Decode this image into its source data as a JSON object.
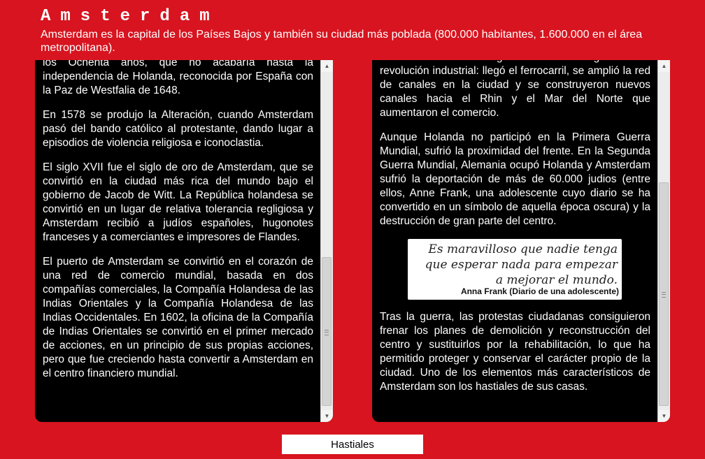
{
  "header": {
    "title": "Amsterdam",
    "subtitle": "Amsterdam es la capital de los Países Bajos y también su ciudad más poblada (800.000 habitantes, 1.600.000 en el área metropolitana)."
  },
  "left_panel": {
    "paragraphs": [
      "los Ochenta años, que no acabaría hasta la independencia de Holanda, reconocida por España con la Paz de Westfalia de 1648.",
      "En 1578 se produjo la Alteración, cuando Amsterdam pasó del bando católico al protestante, dando lugar a episodios de violencia religiosa e iconoclastia.",
      "El siglo XVII fue el siglo de oro de Amsterdam, que se convirtió en la ciudad más rica del mundo bajo el gobierno de Jacob de Witt. La República holandesa se convirtió en un lugar de relativa tolerancia regligiosa y Amsterdam recibió a judíos españoles, hugonotes franceses y a comerciantes e impresores de Flandes.",
      "El puerto de Amsterdam se convirtió en el corazón de una red de comercio mundial, basada en dos compañías comerciales, la Compañía Holandesa de las Indias Orientales y la Compañía Holandesa de las Indias Occidentales. En 1602, la oficina de la Compañía de Indias Orientales se convirtió en el primer mercado de acciones, en un principio de sus propias acciones, pero que fue creciendo hasta convertir a Amsterdam en el centro financiero mundial."
    ]
  },
  "right_panel": {
    "paragraphs": [
      "Amsterdam tuvo una segunda edad de oro gracias a la revolución industrial: llegó el ferrocarril, se amplió la red de canales en la ciudad y se construyeron nuevos canales hacia el Rhin y el Mar del Norte que aumentaron el comercio.",
      "Aunque Holanda no participó en la Primera Guerra Mundial, sufrió la proximidad del frente. En la Segunda Guerra Mundial, Alemania ocupó Holanda y Amsterdam sufrió la deportación de más de 60.000 judios (entre ellos, Anne Frank, una adolescente cuyo diario se ha convertido en un símbolo de aquella época oscura) y la destrucción de gran parte del centro."
    ],
    "quote": {
      "text": "Es maravilloso que nadie tenga que esperar nada para empezar a mejorar el mundo.",
      "author": "Anna Frank (Diario de una adolescente)"
    },
    "paragraph_after_quote": "Tras la guerra, las protestas ciudadanas consiguieron frenar los planes de demolición y reconstrucción del centro y sustituirlos por la rehabilitación, lo que ha permitido proteger y conservar el carácter propio de la ciudad. Uno de los elementos más característicos de Amsterdam son los hastiales de sus casas."
  },
  "navigation": {
    "next_label": "Hastiales"
  },
  "colors": {
    "background": "#d7141f",
    "panel": "#000000",
    "text": "#ffffff"
  },
  "icons": {
    "scroll_up": "triangle-up",
    "scroll_down": "triangle-down"
  }
}
